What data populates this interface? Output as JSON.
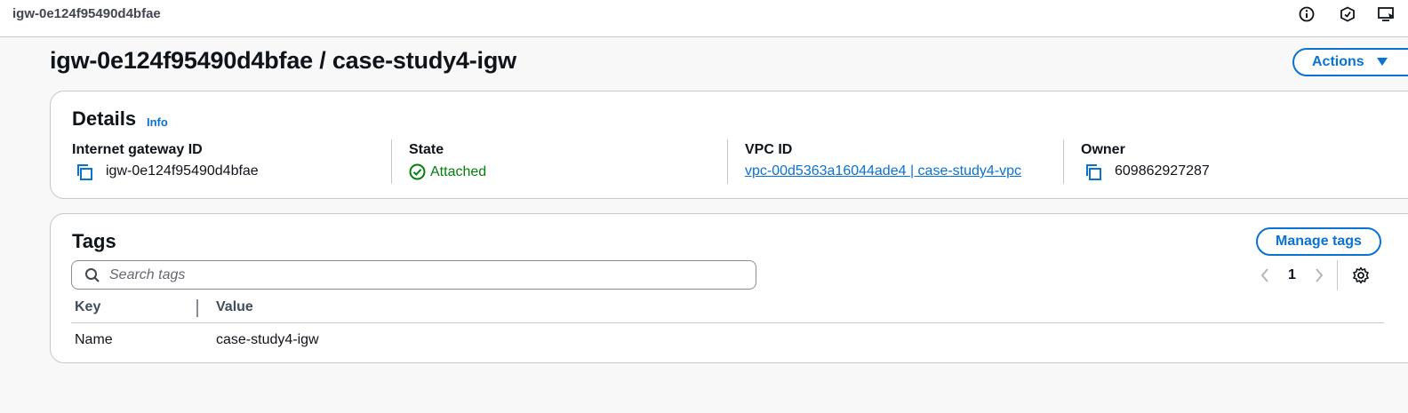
{
  "topbar": {
    "title": "igw-0e124f95490d4bfae",
    "icons": [
      "info-circle-icon",
      "shield-icon",
      "monitor-icon"
    ]
  },
  "header": {
    "title": "igw-0e124f95490d4bfae / case-study4-igw",
    "actions_label": "Actions"
  },
  "details": {
    "heading": "Details",
    "info_label": "Info",
    "columns": [
      {
        "label": "Internet gateway ID",
        "value": "igw-0e124f95490d4bfae"
      },
      {
        "label": "State",
        "value": "Attached"
      },
      {
        "label": "VPC ID",
        "value": "vpc-00d5363a16044ade4 | case-study4-vpc"
      },
      {
        "label": "Owner",
        "value": "609862927287"
      }
    ]
  },
  "tags": {
    "heading": "Tags",
    "manage_label": "Manage tags",
    "search_placeholder": "Search tags",
    "page": "1",
    "columns": [
      "Key",
      "Value"
    ],
    "rows": [
      {
        "key": "Name",
        "value": "case-study4-igw"
      }
    ]
  },
  "colors": {
    "accent": "#0972d3",
    "success": "#037f0c",
    "border": "#c6c6cd",
    "background": "#f8f8f8"
  }
}
